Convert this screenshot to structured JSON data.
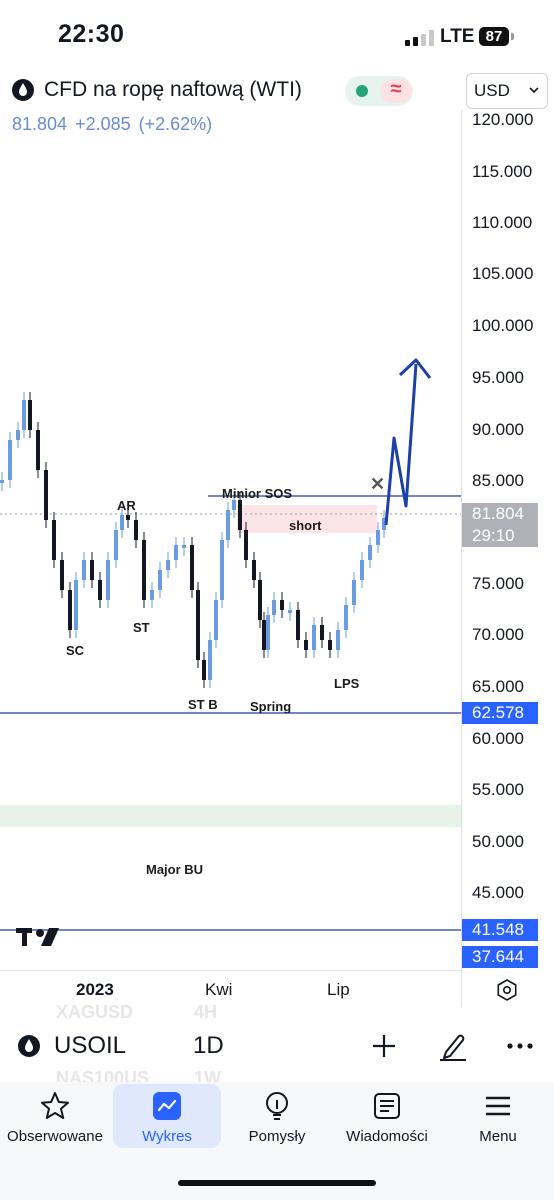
{
  "status_bar": {
    "time": "22:30",
    "network": "LTE",
    "battery": "87"
  },
  "header": {
    "title": "CFD na ropę naftową (WTI)",
    "currency": "USD",
    "quote": {
      "last": "81.804",
      "change": "+2.085",
      "change_pct": "(+2.62%)"
    }
  },
  "colors": {
    "accent": "#2962ff",
    "candle_up": "#6b9be0",
    "candle_down": "#131722",
    "line_blue": "#1c3fa8"
  },
  "price_axis": {
    "ticks": [
      "120.000",
      "115.000",
      "110.000",
      "105.000",
      "100.000",
      "95.000",
      "90.000",
      "85.000",
      "75.000",
      "70.000",
      "65.000",
      "60.000",
      "55.000",
      "50.000",
      "45.000"
    ],
    "current_price": "81.804",
    "countdown": "29:10",
    "level_1": "62.578",
    "level_2": "41.548",
    "level_3": "37.644"
  },
  "time_axis": {
    "labels": [
      "2023",
      "Kwi",
      "Lip"
    ]
  },
  "annotations": {
    "ar": "AR",
    "sc": "SC",
    "st": "ST",
    "st_b": "ST B",
    "spring": "Spring",
    "lps": "LPS",
    "minior_sos": "Minior SOS",
    "short": "short",
    "major_bu": "Major BU"
  },
  "symbol_bar": {
    "symbol": "USOIL",
    "interval": "1D",
    "ghost_symbol_1": "XAGUSD",
    "ghost_interval_1": "4H",
    "ghost_symbol_2": "NAS100US",
    "ghost_interval_2": "1W"
  },
  "bottom_nav": {
    "items": [
      {
        "label": "Obserwowane",
        "icon": "star-icon"
      },
      {
        "label": "Wykres",
        "icon": "chart-icon"
      },
      {
        "label": "Pomysły",
        "icon": "lightbulb-icon"
      },
      {
        "label": "Wiadomości",
        "icon": "news-icon"
      },
      {
        "label": "Menu",
        "icon": "menu-icon"
      }
    ]
  }
}
